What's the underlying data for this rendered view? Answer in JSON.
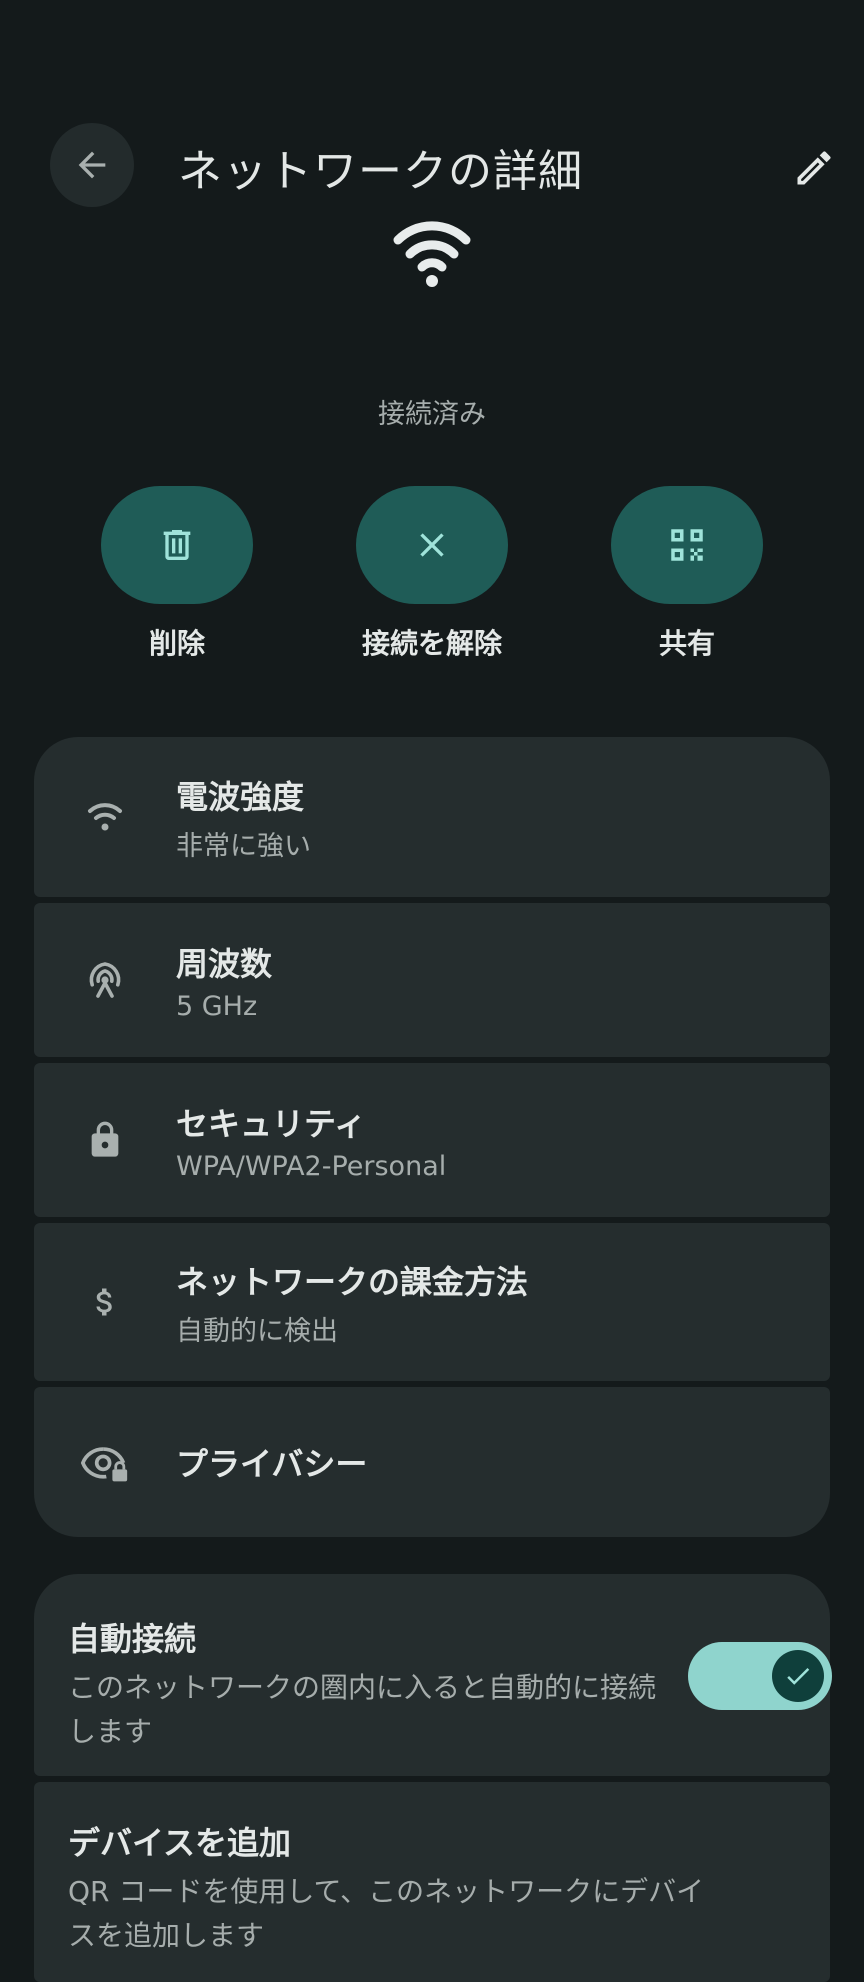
{
  "header": {
    "title": "ネットワークの詳細",
    "back_icon": "arrow-back-icon",
    "edit_icon": "pencil-icon"
  },
  "status": "接続済み",
  "actions": [
    {
      "label": "削除",
      "icon": "trash-icon"
    },
    {
      "label": "接続を解除",
      "icon": "close-icon"
    },
    {
      "label": "共有",
      "icon": "qr-code-icon"
    }
  ],
  "details": [
    {
      "title": "電波強度",
      "subtitle": "非常に強い",
      "icon": "wifi-signal-icon"
    },
    {
      "title": "周波数",
      "subtitle": "5 GHz",
      "icon": "antenna-icon"
    },
    {
      "title": "セキュリティ",
      "subtitle": "WPA/WPA2-Personal",
      "icon": "lock-icon"
    },
    {
      "title": "ネットワークの課金方法",
      "subtitle": "自動的に検出",
      "icon": "dollar-icon"
    },
    {
      "title": "プライバシー",
      "icon": "eye-lock-icon"
    }
  ],
  "auto_connect": {
    "title": "自動接続",
    "subtitle": "このネットワークの圏内に入ると自動的に接続します",
    "enabled": true
  },
  "add_device": {
    "title": "デバイスを追加",
    "subtitle": "QR コードを使用して、このネットワークにデバイスを追加します"
  },
  "colors": {
    "background": "#141a1b",
    "card": "#252d2e",
    "accent_pill": "#1f5c57",
    "accent_icon": "#9fe3da",
    "switch_track": "#8fd4cd"
  }
}
